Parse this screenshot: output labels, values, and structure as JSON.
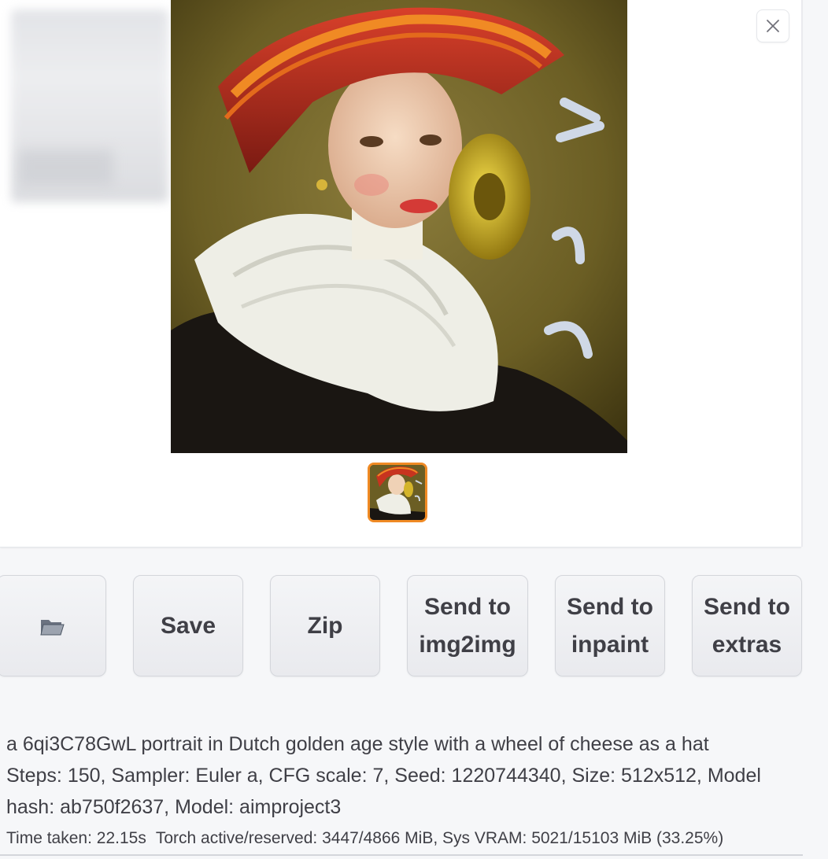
{
  "gallery": {
    "close_icon": "close-icon",
    "main_image_alt": "portrait-painting",
    "thumbnail_selected": true,
    "accent_color": "#f08a24"
  },
  "actions": {
    "folder_icon": "folder-icon",
    "save_label": "Save",
    "zip_label": "Zip",
    "send_img2img_line1": "Send to",
    "send_img2img_line2": "img2img",
    "send_inpaint_line1": "Send to",
    "send_inpaint_line2": "inpaint",
    "send_extras_line1": "Send to",
    "send_extras_line2": "extras"
  },
  "generation_info": {
    "prompt": "a 6qi3C78GwL portrait in Dutch golden age style with a wheel of cheese as a hat",
    "params_line1": "Steps: 150, Sampler: Euler a, CFG scale: 7, Seed: 1220744340, Size: 512x512, Model",
    "params_line2": "hash: ab750f2637, Model: aimproject3"
  },
  "stats": {
    "time_taken": "Time taken: 22.15s",
    "torch_memory": "Torch active/reserved: 3447/4866 MiB, Sys VRAM: 5021/15103 MiB (33.25%)"
  }
}
